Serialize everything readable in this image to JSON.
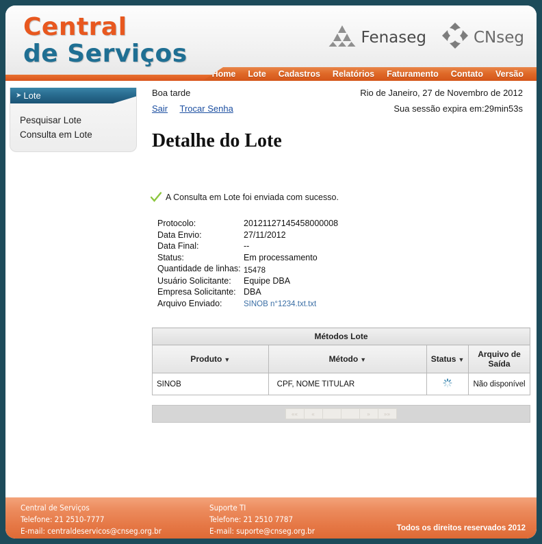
{
  "header": {
    "logo_line1": "Central",
    "logo_line2": "de Serviços",
    "brands": [
      {
        "name": "Fenaseg",
        "icon": "fenaseg-triangle-logo"
      },
      {
        "name": "CNseg",
        "icon": "cnseg-pinwheel-logo"
      }
    ],
    "nav": [
      {
        "label": "Home"
      },
      {
        "label": "Lote"
      },
      {
        "label": "Cadastros"
      },
      {
        "label": "Relatórios"
      },
      {
        "label": "Faturamento"
      },
      {
        "label": "Contato"
      },
      {
        "label": "Versão"
      }
    ]
  },
  "sidebar": {
    "section_title": "Lote",
    "items": [
      {
        "label": "Pesquisar Lote"
      },
      {
        "label": "Consulta em Lote"
      }
    ]
  },
  "topbar": {
    "greeting": "Boa tarde",
    "location_date": "Rio de Janeiro, 27 de Novembro de 2012",
    "logout_label": "Sair",
    "change_password_label": "Trocar Senha",
    "session_expiry": "Sua sessão expira em:29min53s"
  },
  "main": {
    "page_title": "Detalhe do Lote",
    "success_message": "A Consulta em Lote foi enviada com sucesso.",
    "details": [
      {
        "label": "Protocolo:",
        "value": "20121127145458000008"
      },
      {
        "label": "Data Envio:",
        "value": "27/11/2012"
      },
      {
        "label": "Data Final:",
        "value": "--"
      },
      {
        "label": "Status:",
        "value": "Em processamento"
      },
      {
        "label": "Quantidade de linhas:",
        "value": "15478"
      },
      {
        "label": "Usuário Solicitante:",
        "value": "Equipe DBA"
      },
      {
        "label": "Empresa Solicitante:",
        "value": "DBA"
      },
      {
        "label": "Arquivo Enviado:",
        "value": "SINOB n°1234.txt.txt"
      }
    ],
    "table": {
      "caption": "Métodos Lote",
      "columns": [
        "Produto",
        "Método",
        "Status",
        "Arquivo de Saída"
      ],
      "rows": [
        {
          "produto": "SINOB",
          "metodo": "CPF, NOME TITULAR",
          "status": "loading-spinner-icon",
          "arquivo_saida": "Não disponível"
        }
      ]
    },
    "pagination": {
      "buttons": [
        "««",
        "«",
        "",
        "",
        "»",
        "»»"
      ]
    }
  },
  "footer": {
    "col1": {
      "title": "Central de Serviços",
      "phone": "Telefone: 21 2510-7777",
      "email": "E-mail: centraldeservicos@cnseg.org.br"
    },
    "col2": {
      "title": "Suporte TI",
      "phone": "Telefone: 21 2510 7787",
      "email": "E-mail: suporte@cnseg.org.br"
    },
    "copyright": "Todos os direitos reservados 2012"
  },
  "colors": {
    "page_border": "#1d4b5a",
    "accent_orange": "#e06a28",
    "logo_orange": "#e8581f",
    "logo_blue": "#1f6f93",
    "link_blue": "#1c4fa1",
    "success_green": "#8cc63f"
  }
}
